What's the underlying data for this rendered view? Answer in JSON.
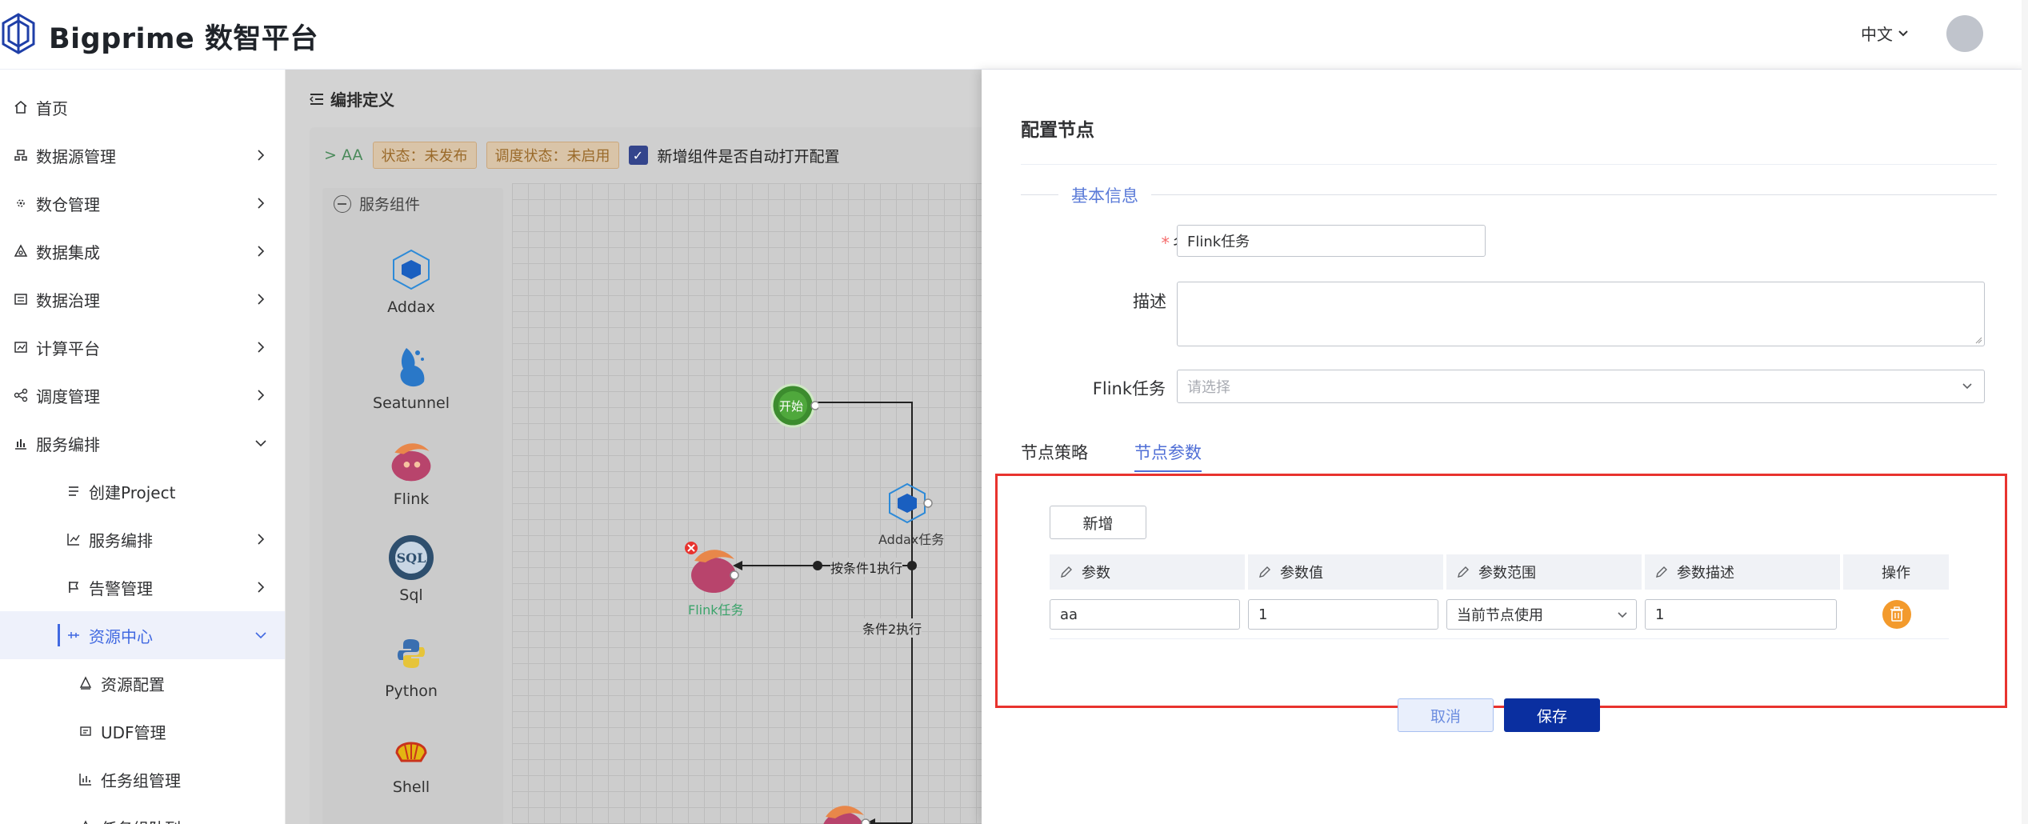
{
  "header": {
    "brand": "Bigprime 数智平台",
    "language": "中文"
  },
  "sidebar": {
    "items": [
      {
        "label": "首页",
        "icon": "home-icon"
      },
      {
        "label": "数据源管理",
        "icon": "database-icon"
      },
      {
        "label": "数仓管理",
        "icon": "warehouse-icon"
      },
      {
        "label": "数据集成",
        "icon": "integration-icon"
      },
      {
        "label": "数据治理",
        "icon": "governance-icon"
      },
      {
        "label": "计算平台",
        "icon": "compute-icon"
      },
      {
        "label": "调度管理",
        "icon": "schedule-icon"
      },
      {
        "label": "服务编排",
        "icon": "chart-icon"
      },
      {
        "label": "创建Project",
        "icon": "list-icon"
      },
      {
        "label": "服务编排",
        "icon": "line-chart-icon"
      },
      {
        "label": "告警管理",
        "icon": "flag-icon"
      },
      {
        "label": "资源中心",
        "icon": "resource-icon"
      },
      {
        "label": "资源配置",
        "icon": "config-icon"
      },
      {
        "label": "UDF管理",
        "icon": "udf-icon"
      },
      {
        "label": "任务组管理",
        "icon": "task-group-icon"
      },
      {
        "label": "任务组队列",
        "icon": "queue-icon"
      }
    ]
  },
  "main": {
    "breadcrumb": "编排定义",
    "project": "AA",
    "status_tag": "状态：未发布",
    "schedule_tag": "调度状态：未启用",
    "auto_open_label": "新增组件是否自动打开配置",
    "palette_title": "服务组件",
    "components": [
      "Addax",
      "Seatunnel",
      "Flink",
      "Sql",
      "Python",
      "Shell"
    ],
    "canvas": {
      "start_label": "开始",
      "addax_task": "Addax任务",
      "flink_task": "Flink任务",
      "cond1": "按条件1执行",
      "cond2": "条件2执行"
    }
  },
  "drawer": {
    "title": "配置节点",
    "section": "基本信息",
    "name_label": "名称",
    "name_value": "Flink任务",
    "desc_label": "描述",
    "flink_label": "Flink任务",
    "flink_placeholder": "请选择",
    "tabs": [
      "节点策略",
      "节点参数"
    ],
    "add_button": "新增",
    "columns": [
      "参数",
      "参数值",
      "参数范围",
      "参数描述",
      "操作"
    ],
    "row": {
      "param": "aa",
      "value": "1",
      "scope": "当前节点使用",
      "description": "1"
    },
    "cancel_button": "取消",
    "save_button": "保存",
    "colors": {
      "accent": "#4f6ed6",
      "save": "#0a2fa0",
      "highlight": "#e8332e",
      "delete": "#f39a2c"
    }
  }
}
